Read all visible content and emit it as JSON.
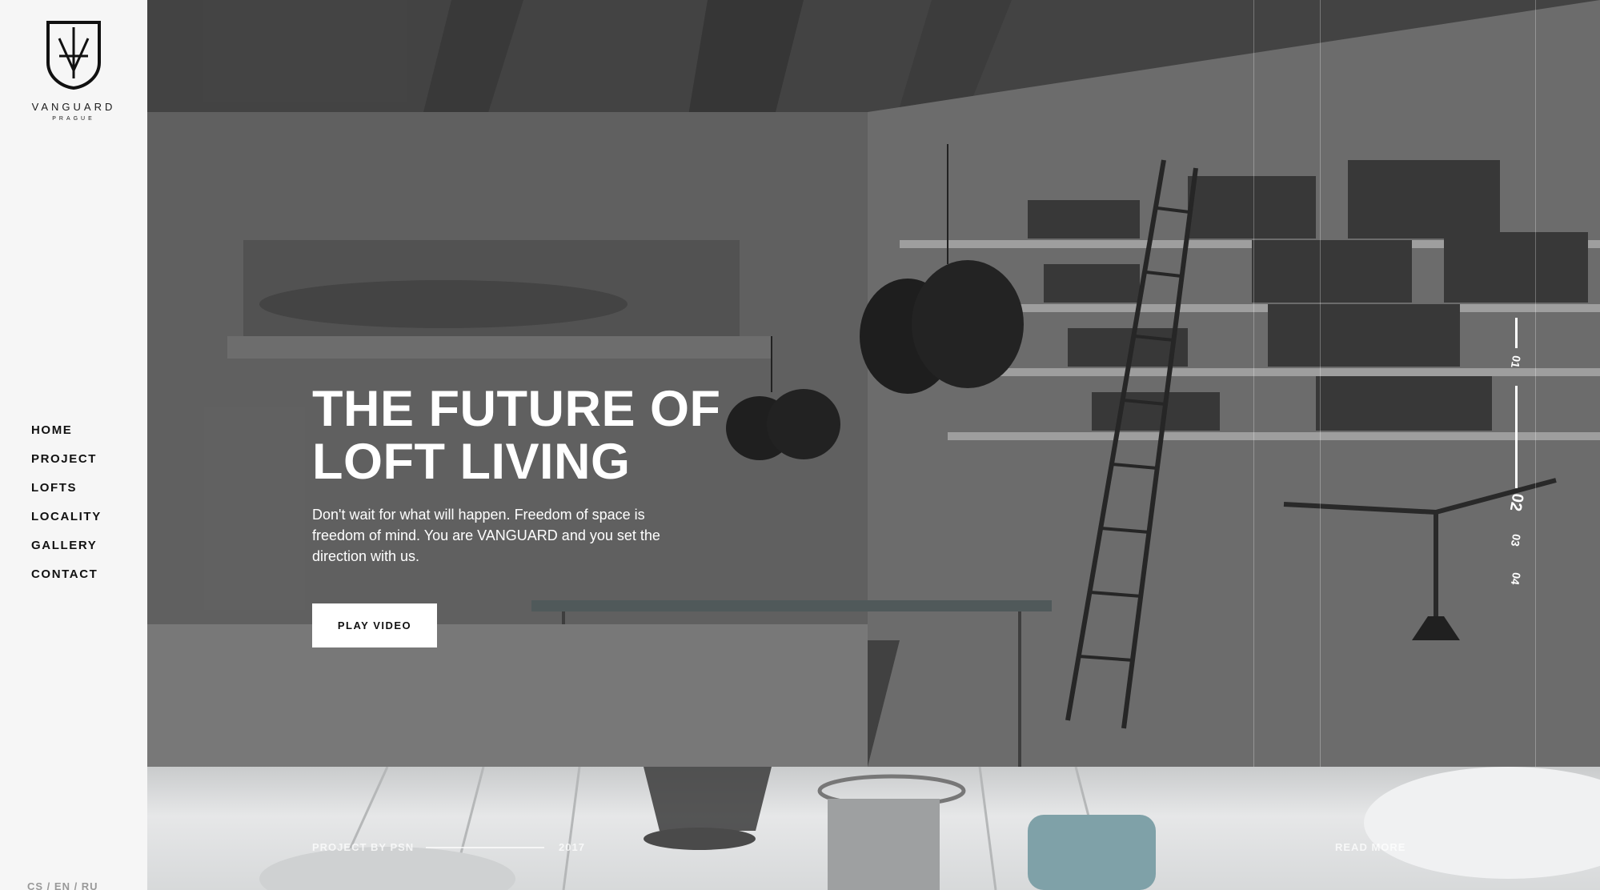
{
  "brand": {
    "name": "VANGUARD",
    "city": "PRAGUE"
  },
  "nav": {
    "items": [
      {
        "label": "HOME"
      },
      {
        "label": "PROJECT"
      },
      {
        "label": "LOFTS"
      },
      {
        "label": "LOCALITY"
      },
      {
        "label": "GALLERY"
      },
      {
        "label": "CONTACT"
      }
    ]
  },
  "languages": "CS / EN / RU",
  "hero": {
    "title_line1": "THE FUTURE OF",
    "title_line2": "LOFT LIVING",
    "description": "Don't wait for what will happen. Freedom of space is freedom of mind. You are VANGUARD and you set the direction with us.",
    "button_label": "PLAY VIDEO"
  },
  "slides": {
    "items": [
      {
        "label": "01"
      },
      {
        "label": "02"
      },
      {
        "label": "03"
      },
      {
        "label": "04"
      }
    ],
    "active": "02"
  },
  "strip": {
    "project_by": "PROJECT BY PSN",
    "year": "2017",
    "read_more": "READ MORE"
  },
  "colors": {
    "sidebar_bg": "#f6f6f6",
    "text_dark": "#111111",
    "hero_overlay": "#5a5a5a",
    "white": "#ffffff"
  }
}
